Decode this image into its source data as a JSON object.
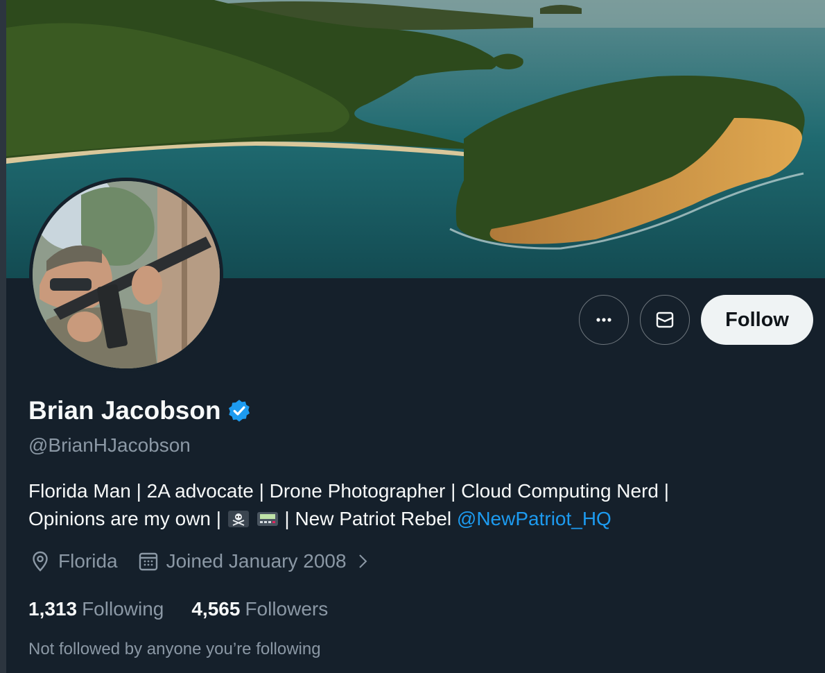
{
  "profile": {
    "display_name": "Brian Jacobson",
    "handle": "@BrianHJacobson",
    "bio": {
      "line1": "Florida Man | 2A advocate | Drone Photographer | Cloud Computing Nerd |",
      "line2_before_emoji": "Opinions are my own |",
      "line2_after_emoji": "| New Patriot Rebel",
      "mention": "@NewPatriot_HQ"
    },
    "location": "Florida",
    "joined": "Joined January 2008"
  },
  "actions": {
    "more_label": "More",
    "message_label": "Message",
    "follow_label": "Follow"
  },
  "stats": {
    "following_count": "1,313",
    "following_label": "Following",
    "followers_count": "4,565",
    "followers_label": "Followers"
  },
  "social_context": "Not followed by anyone you’re following",
  "icons": {
    "verified": "verified-badge-icon",
    "location": "location-pin-icon",
    "calendar": "calendar-icon",
    "more": "ellipsis-icon",
    "message": "envelope-icon"
  },
  "colors": {
    "background": "#15202b",
    "accent": "#1d9bf0",
    "secondary_text": "#8b98a5",
    "follow_button": "#eff3f4"
  }
}
